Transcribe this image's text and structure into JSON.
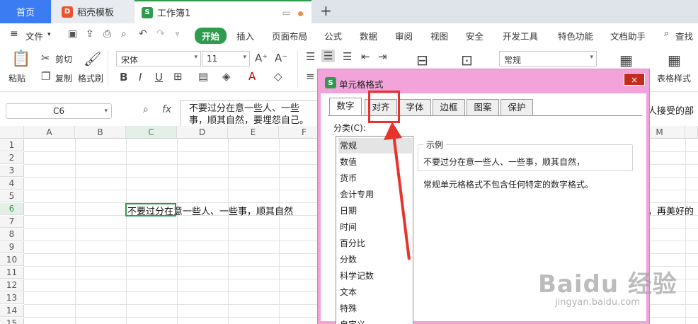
{
  "tabs": {
    "home": "首页",
    "template": "稻壳模板",
    "workbook": "工作簿1"
  },
  "menu": {
    "file": "文件",
    "items": [
      "开始",
      "插入",
      "页面布局",
      "公式",
      "数据",
      "审阅",
      "视图",
      "安全",
      "开发工具",
      "特色功能",
      "文档助手"
    ],
    "search": "查找"
  },
  "ribbon": {
    "paste": "粘贴",
    "cut": "剪切",
    "copy": "复制",
    "format_painter": "格式刷",
    "font_name": "宋体",
    "font_size": "11",
    "number_format": "常规",
    "table_style": "表格样式"
  },
  "formula_bar": {
    "name_box": "C6",
    "fx": "fx",
    "text": "不要过分在意一些人、一些事，顺其自然，要埋怨自己。",
    "text_tail": "人接受的部"
  },
  "grid": {
    "columns": [
      "A",
      "B",
      "C",
      "D",
      "E",
      "F",
      "M"
    ],
    "rows": [
      "1",
      "2",
      "3",
      "4",
      "5",
      "6",
      "7",
      "8",
      "9",
      "10",
      "11",
      "12",
      "13",
      "14",
      "15"
    ],
    "cell_text": "不要过分在意一些人、一些事，顺其自然",
    "cell_tail": "，再美好的"
  },
  "dialog": {
    "title": "单元格格式",
    "close": "×",
    "tabs": [
      "数字",
      "对齐",
      "字体",
      "边框",
      "图案",
      "保护"
    ],
    "category_label": "分类(C):",
    "categories": [
      "常规",
      "数值",
      "货币",
      "会计专用",
      "日期",
      "时间",
      "百分比",
      "分数",
      "科学记数",
      "文本",
      "特殊",
      "自定义"
    ],
    "sample_label": "示例",
    "sample_text": "不要过分在意一些人、一些事，顺其自然，",
    "description": "常规单元格格式不包含任何特定的数字格式。"
  },
  "watermark": {
    "main": "Baidu 经验",
    "sub": "jingyan.baidu.com"
  },
  "colors": {
    "accent_green": "#2f9b4d",
    "home_tab_blue": "#3c7cf2",
    "dialog_pink": "#f2a3da",
    "annotation_red": "#e8322e"
  }
}
